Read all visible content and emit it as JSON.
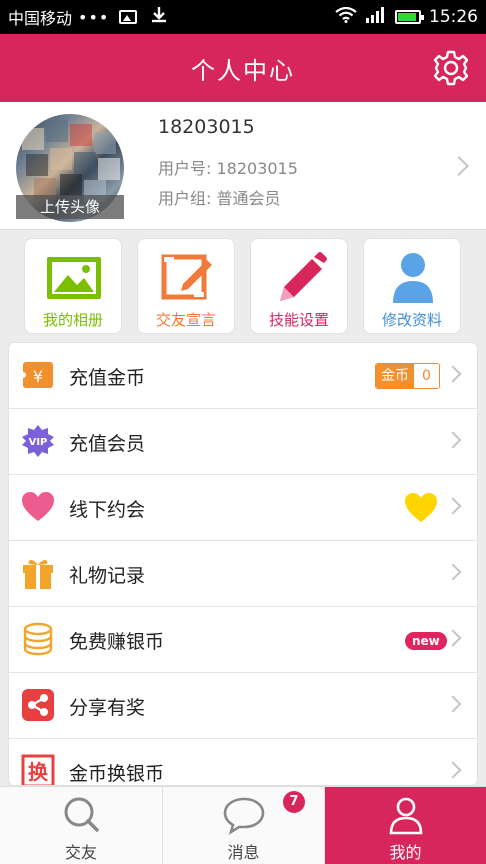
{
  "status_bar": {
    "carrier": "中国移动",
    "dots": "•••",
    "time": "15:26",
    "icons": [
      "image-icon",
      "download-icon",
      "wifi-icon",
      "signal-icon",
      "battery-icon"
    ]
  },
  "header": {
    "title": "个人中心",
    "settings_icon": "gear-icon",
    "color": "#d6265c"
  },
  "profile": {
    "name": "18203015",
    "user_id": "用户号: 18203015",
    "user_group": "用户组: 普通会员",
    "upload_avatar_label": "上传头像"
  },
  "quick_actions": [
    {
      "label": "我的相册",
      "icon": "photo-album-icon",
      "color": "#7bc000"
    },
    {
      "label": "交友宣言",
      "icon": "edit-note-icon",
      "color": "#f07a3a"
    },
    {
      "label": "技能设置",
      "icon": "pencil-icon",
      "color": "#d6265c"
    },
    {
      "label": "修改资料",
      "icon": "person-icon",
      "color": "#3d8fd8"
    }
  ],
  "menu": [
    {
      "label": "充值金币",
      "icon": "coin-yuan-icon",
      "badge_left": "金币",
      "badge_right": "0"
    },
    {
      "label": "充值会员",
      "icon": "vip-icon"
    },
    {
      "label": "线下约会",
      "icon": "heart-icon",
      "badge_icon": "yellow-heart-icon"
    },
    {
      "label": "礼物记录",
      "icon": "gift-icon"
    },
    {
      "label": "免费赚银币",
      "icon": "coin-stack-icon",
      "badge": "new"
    },
    {
      "label": "分享有奖",
      "icon": "share-icon"
    },
    {
      "label": "金币换银币",
      "icon": "exchange-icon",
      "icon_text": "换"
    }
  ],
  "bottom_nav": [
    {
      "label": "交友",
      "icon": "search-icon"
    },
    {
      "label": "消息",
      "icon": "chat-bubble-icon",
      "badge": "7"
    },
    {
      "label": "我的",
      "icon": "user-icon",
      "active": true
    }
  ]
}
